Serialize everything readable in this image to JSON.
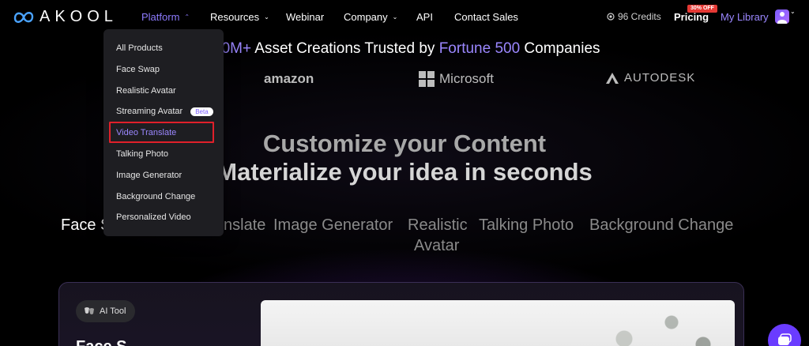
{
  "nav": {
    "logo_text": "AKOOL",
    "items": [
      {
        "label": "Platform",
        "has_caret": true,
        "active": true
      },
      {
        "label": "Resources",
        "has_caret": true
      },
      {
        "label": "Webinar",
        "has_caret": false
      },
      {
        "label": "Company",
        "has_caret": true
      },
      {
        "label": "API",
        "has_caret": false
      },
      {
        "label": "Contact Sales",
        "has_caret": false
      }
    ],
    "credits": "96 Credits",
    "pricing_label": "Pricing",
    "pricing_badge": "30% OFF",
    "library_label": "My Library"
  },
  "hero": {
    "trusted_prefix": "10M+",
    "trusted_middle": " Asset Creations Trusted by ",
    "trusted_highlight": "Fortune 500",
    "trusted_suffix": " Companies",
    "brands": [
      "amazon",
      "Microsoft",
      "AUTODESK"
    ],
    "headline_1": "Customize your Content",
    "headline_2": "Materialize your idea in seconds"
  },
  "tabs": [
    {
      "label": "Face S",
      "active": true
    },
    {
      "label": "nslate"
    },
    {
      "label": "Image Generator"
    },
    {
      "label": "Realistic"
    },
    {
      "label": "Avatar"
    },
    {
      "label": "Talking Photo"
    },
    {
      "label": "Background Change"
    }
  ],
  "card": {
    "badge_label": "AI Tool",
    "title_fragment": "Face S"
  },
  "dropdown": {
    "items": [
      {
        "label": "All Products"
      },
      {
        "label": "Face Swap"
      },
      {
        "label": "Realistic Avatar"
      },
      {
        "label": "Streaming Avatar",
        "badge": "Beta"
      },
      {
        "label": "Video Translate",
        "highlighted": true
      },
      {
        "label": "Talking Photo"
      },
      {
        "label": "Image Generator"
      },
      {
        "label": "Background Change"
      },
      {
        "label": "Personalized Video"
      }
    ]
  },
  "colors": {
    "accent": "#9b87ff",
    "highlight_outline": "#e0202a",
    "badge_red": "#e53935",
    "chat_button": "#6a3cff"
  }
}
